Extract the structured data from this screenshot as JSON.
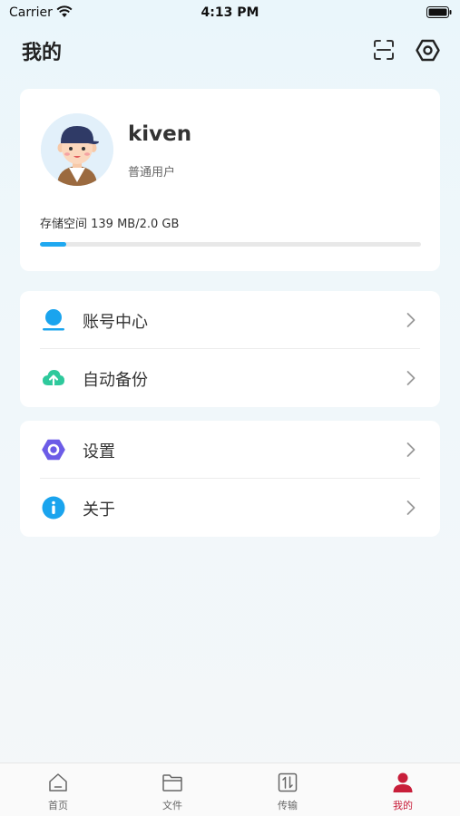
{
  "status_bar": {
    "carrier": "Carrier",
    "time": "4:13 PM"
  },
  "header": {
    "title": "我的",
    "scan_icon": "scan-icon",
    "settings_icon": "settings-hex-icon"
  },
  "profile": {
    "username": "kiven",
    "level": "普通用户",
    "storage_text": "存储空间 139 MB/2.0 GB",
    "storage_fraction": 0.068,
    "storage_color": "#1fa8f0"
  },
  "menu_group_1": [
    {
      "label": "账号中心",
      "icon": "account-icon",
      "color": "#1aa4ee"
    },
    {
      "label": "自动备份",
      "icon": "cloud-upload-icon",
      "color": "#2ec99c"
    }
  ],
  "menu_group_2": [
    {
      "label": "设置",
      "icon": "settings-icon",
      "color": "#6c5ce7"
    },
    {
      "label": "关于",
      "icon": "info-icon",
      "color": "#1aa4ee"
    }
  ],
  "tab_bar": {
    "items": [
      {
        "label": "首页",
        "icon": "home-icon"
      },
      {
        "label": "文件",
        "icon": "folder-icon"
      },
      {
        "label": "传输",
        "icon": "transfer-icon"
      },
      {
        "label": "我的",
        "icon": "user-icon"
      }
    ],
    "active_index": 3,
    "active_color": "#c81e3a"
  }
}
